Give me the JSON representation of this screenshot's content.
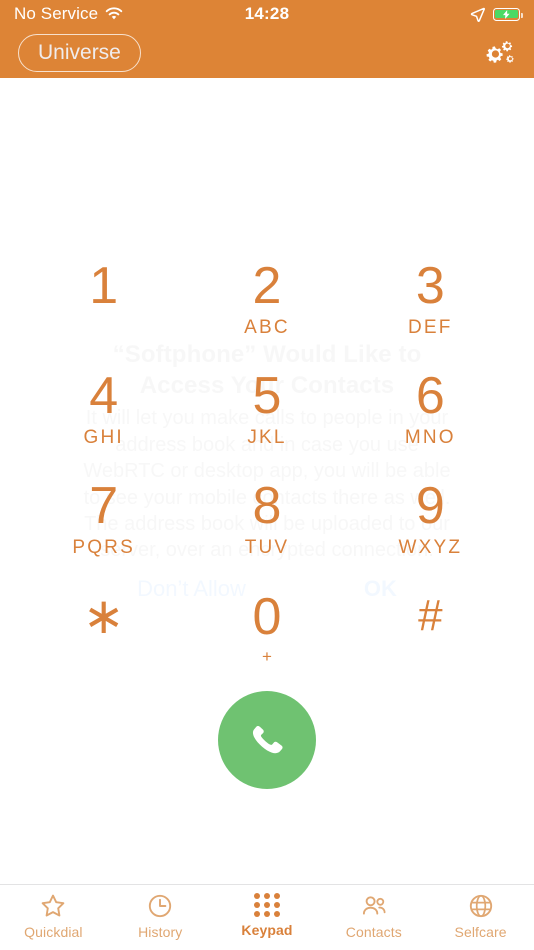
{
  "status_bar": {
    "carrier": "No Service",
    "time": "14:28",
    "wifi_icon": "wifi-icon",
    "location_icon": "location-arrow-icon",
    "battery_icon": "battery-charging-icon",
    "battery_color": "#4cd964"
  },
  "nav_bar": {
    "account_label": "Universe",
    "settings_icon": "gears-icon",
    "background_color": "#dd8436"
  },
  "dialer": {
    "number_value": "",
    "number_placeholder": "",
    "accent_color": "#d9813b",
    "keys": [
      {
        "digit": "1",
        "letters": ""
      },
      {
        "digit": "2",
        "letters": "ABC"
      },
      {
        "digit": "3",
        "letters": "DEF"
      },
      {
        "digit": "4",
        "letters": "GHI"
      },
      {
        "digit": "5",
        "letters": "JKL"
      },
      {
        "digit": "6",
        "letters": "MNO"
      },
      {
        "digit": "7",
        "letters": "PQRS"
      },
      {
        "digit": "8",
        "letters": "TUV"
      },
      {
        "digit": "9",
        "letters": "WXYZ"
      },
      {
        "digit": "∗",
        "letters": ""
      },
      {
        "digit": "0",
        "letters": "+"
      },
      {
        "digit": "#",
        "letters": ""
      }
    ],
    "call_button": {
      "icon": "phone-handset-icon",
      "color": "#6fc271"
    }
  },
  "permission_alert": {
    "title": "“Softphone” Would Like to Access Your Contacts",
    "message": "It will let you make calls to people in your address book and in case you use WebRTC or desktop app, you will be able to see your mobile contacts there as well. The address book will be uploaded to our server, over an encrypted connection.",
    "deny_label": "Don’t Allow",
    "allow_label": "OK"
  },
  "tab_bar": {
    "active_index": 2,
    "tabs": [
      {
        "label": "Quickdial",
        "icon": "star-icon"
      },
      {
        "label": "History",
        "icon": "clock-icon"
      },
      {
        "label": "Keypad",
        "icon": "keypad-dots-icon"
      },
      {
        "label": "Contacts",
        "icon": "people-icon"
      },
      {
        "label": "Selfcare",
        "icon": "globe-icon"
      }
    ],
    "active_color": "#d9813b",
    "inactive_color": "#e0a772"
  }
}
